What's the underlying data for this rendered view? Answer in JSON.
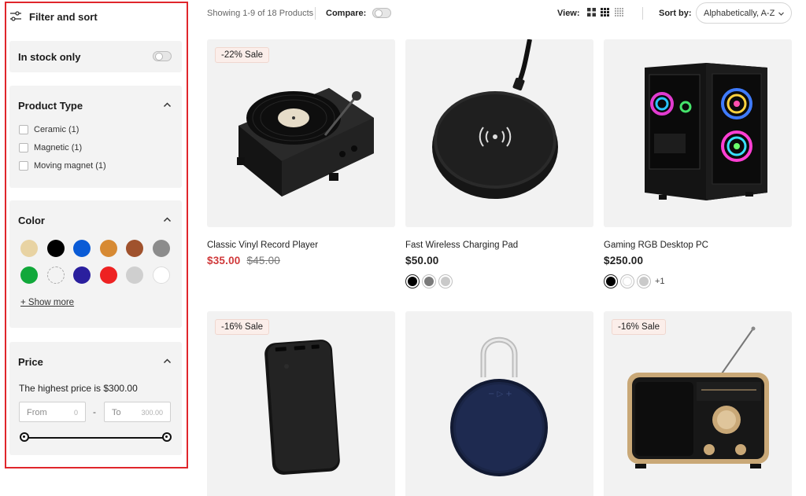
{
  "sidebar": {
    "title": "Filter and sort",
    "in_stock": {
      "label": "In stock only",
      "on": false
    },
    "product_type": {
      "title": "Product Type",
      "options": [
        "Ceramic (1)",
        "Magnetic (1)",
        "Moving magnet (1)"
      ]
    },
    "color": {
      "title": "Color",
      "swatches": [
        "#e8d3a3",
        "#000000",
        "#0a5bd6",
        "#d78a33",
        "#a0522d",
        "#8c8c8c",
        "#11a83a",
        "#ffffff",
        "#2a1f9e",
        "#ee2222",
        "#cfcfcf",
        "#ffffff"
      ],
      "show_more": "+ Show more"
    },
    "price": {
      "title": "Price",
      "note": "The highest price is $300.00",
      "from_label": "From",
      "from_value": "0",
      "separator": "-",
      "to_label": "To",
      "to_value": "300.00"
    }
  },
  "toolbar": {
    "showing": "Showing 1-9 of 18 Products",
    "compare_label": "Compare:",
    "view_label": "View:",
    "sort_label": "Sort by:",
    "sort_value": "Alphabetically, A-Z"
  },
  "products": [
    {
      "name": "Classic Vinyl Record Player",
      "badge": "-22% Sale",
      "price": "$35.00",
      "old_price": "$45.00",
      "colors": [],
      "more": ""
    },
    {
      "name": "Fast Wireless Charging Pad",
      "badge": "",
      "price": "$50.00",
      "old_price": "",
      "colors": [
        "#000000",
        "#7a7a7a",
        "#c9c9c9"
      ],
      "more": ""
    },
    {
      "name": "Gaming RGB Desktop PC",
      "badge": "",
      "price": "$250.00",
      "old_price": "",
      "colors": [
        "#000000",
        "#ffffff",
        "#c9c9c9"
      ],
      "more": "+1"
    },
    {
      "name": "",
      "badge": "-16% Sale",
      "price": "",
      "old_price": "",
      "colors": [],
      "more": ""
    },
    {
      "name": "",
      "badge": "",
      "price": "",
      "old_price": "",
      "colors": [],
      "more": ""
    },
    {
      "name": "",
      "badge": "-16% Sale",
      "price": "",
      "old_price": "",
      "colors": [],
      "more": ""
    }
  ]
}
